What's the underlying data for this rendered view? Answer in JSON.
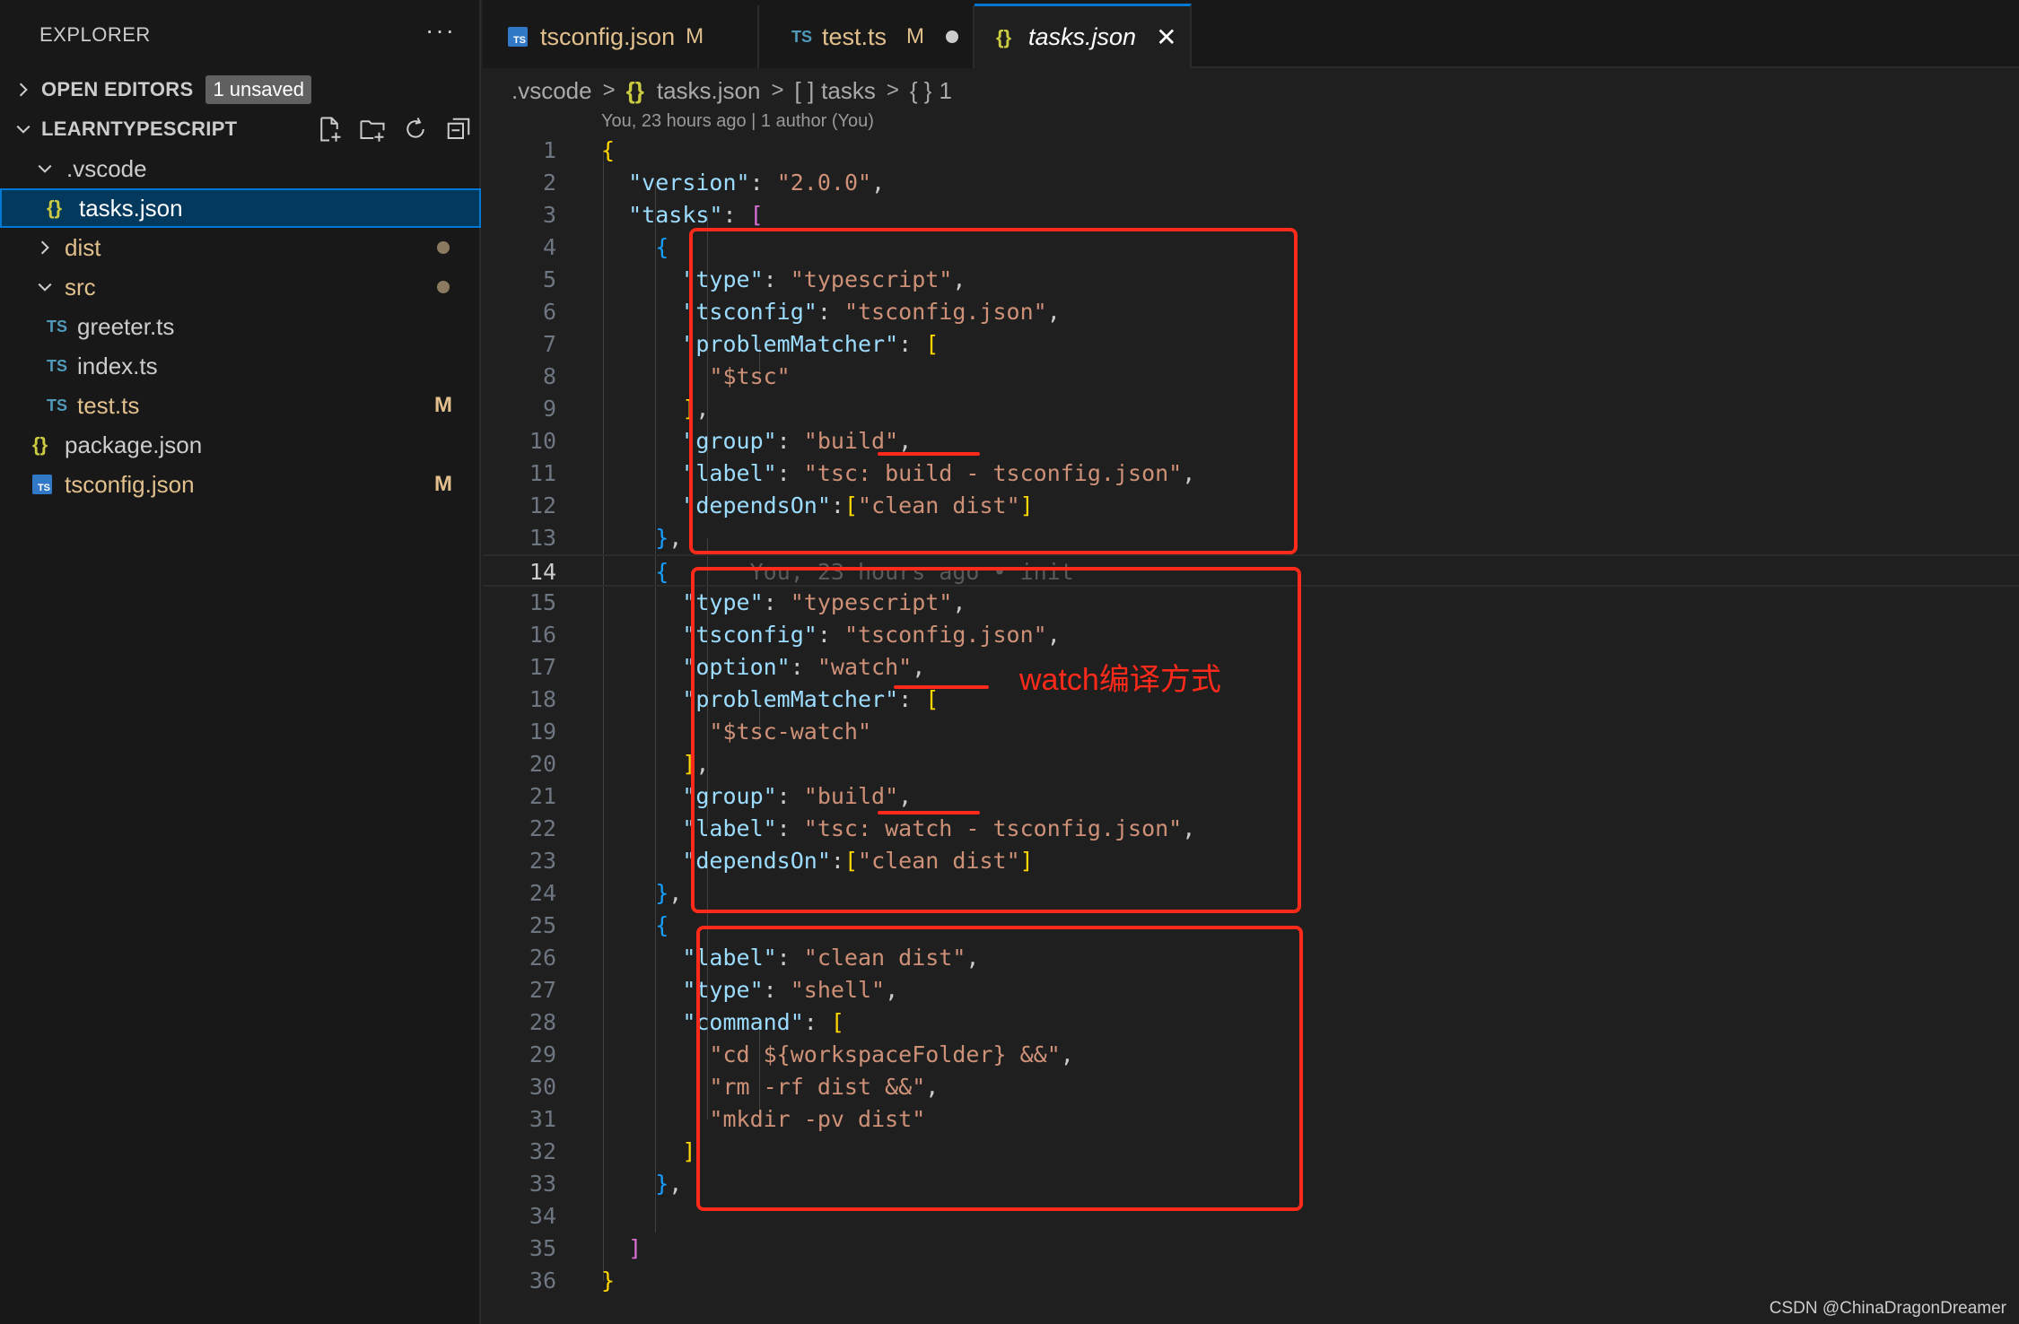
{
  "explorer": {
    "title": "EXPLORER",
    "more": "···",
    "open_editors": {
      "label": "OPEN EDITORS",
      "badge": "1 unsaved"
    },
    "project": {
      "label": "LEARNTYPESCRIPT",
      "items": [
        {
          "name": ".vscode",
          "type": "folder",
          "expanded": true
        },
        {
          "name": "tasks.json",
          "type": "json",
          "selected": true
        },
        {
          "name": "dist",
          "type": "folder",
          "expanded": false
        },
        {
          "name": "src",
          "type": "folder",
          "expanded": true
        },
        {
          "name": "greeter.ts",
          "type": "ts"
        },
        {
          "name": "index.ts",
          "type": "ts"
        },
        {
          "name": "test.ts",
          "type": "ts",
          "status": "M"
        },
        {
          "name": "package.json",
          "type": "json"
        },
        {
          "name": "tsconfig.json",
          "type": "tsconfig",
          "status": "M"
        }
      ]
    }
  },
  "tabs": [
    {
      "label": "tsconfig.json",
      "status": "M"
    },
    {
      "label": "test.ts",
      "status": "M",
      "unsaved": true
    },
    {
      "label": "tasks.json",
      "active": true
    }
  ],
  "breadcrumb": {
    "folder": ".vscode",
    "file": "tasks.json",
    "node1_icon": "[ ]",
    "node1": "tasks",
    "node2_icon": "{ }",
    "node2": "1"
  },
  "codelens": "You, 23 hours ago | 1 author (You)",
  "ghost_blame": "You, 23 hours ago • init",
  "line_numbers": [
    "1",
    "2",
    "3",
    "4",
    "5",
    "6",
    "7",
    "8",
    "9",
    "10",
    "11",
    "12",
    "13",
    "14",
    "15",
    "16",
    "17",
    "18",
    "19",
    "20",
    "21",
    "22",
    "23",
    "24",
    "25",
    "26",
    "27",
    "28",
    "29",
    "30",
    "31",
    "32",
    "33",
    "34",
    "35",
    "36"
  ],
  "code": {
    "version_key": "\"version\"",
    "version_val": "\"2.0.0\"",
    "tasks_key": "\"tasks\"",
    "type_key": "\"type\"",
    "typescript": "\"typescript\"",
    "tsconfig_key": "\"tsconfig\"",
    "tsconfig_val": "\"tsconfig.json\"",
    "pm_key": "\"problemMatcher\"",
    "tsc": "\"$tsc\"",
    "tsc_watch": "\"$tsc-watch\"",
    "group_key": "\"group\"",
    "build": "\"build\"",
    "label_key": "\"label\"",
    "label1": "\"tsc: build - tsconfig.json\"",
    "label2": "\"tsc: watch - tsconfig.json\"",
    "depends_key": "\"dependsOn\"",
    "clean_dist": "\"clean dist\"",
    "option_key": "\"option\"",
    "watch": "\"watch\"",
    "shell": "\"shell\"",
    "command_key": "\"command\"",
    "cmd1": "\"cd ${workspaceFolder} &&\"",
    "cmd2": "\"rm -rf dist &&\"",
    "cmd3": "\"mkdir -pv dist\""
  },
  "annotation": "watch编译方式",
  "watermark": "CSDN @ChinaDragonDreamer",
  "colors": {
    "accent": "#0078d4",
    "annotation": "#ff2a1a",
    "modified": "#e2c08d"
  }
}
